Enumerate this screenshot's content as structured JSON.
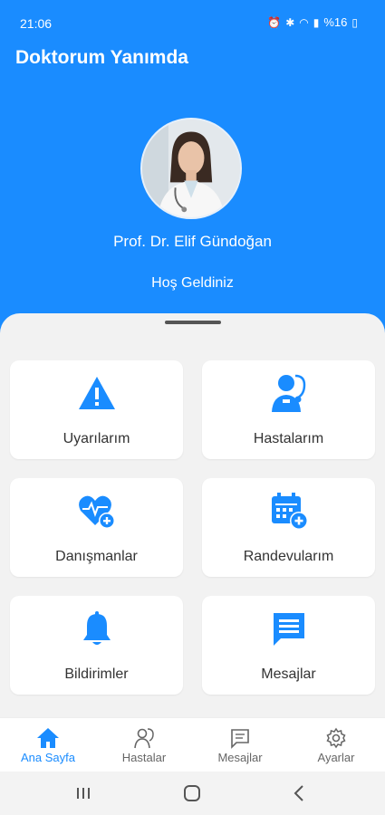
{
  "status": {
    "time": "21:06",
    "battery": "%16"
  },
  "app": {
    "title": "Doktorum Yanımda"
  },
  "profile": {
    "name": "Prof. Dr. Elif Gündoğan",
    "welcome": "Hoş Geldiniz"
  },
  "cards": [
    {
      "label": "Uyarılarım",
      "icon": "warning-icon"
    },
    {
      "label": "Hastalarım",
      "icon": "doctor-stethoscope-icon"
    },
    {
      "label": "Danışmanlar",
      "icon": "heart-plus-icon"
    },
    {
      "label": "Randevularım",
      "icon": "calendar-plus-icon"
    },
    {
      "label": "Bildirimler",
      "icon": "bell-icon"
    },
    {
      "label": "Mesajlar",
      "icon": "message-icon"
    }
  ],
  "nav": [
    {
      "label": "Ana Sayfa",
      "icon": "home-icon",
      "active": true
    },
    {
      "label": "Hastalar",
      "icon": "patients-icon",
      "active": false
    },
    {
      "label": "Mesajlar",
      "icon": "chat-icon",
      "active": false
    },
    {
      "label": "Ayarlar",
      "icon": "gear-icon",
      "active": false
    }
  ],
  "colors": {
    "primary": "#1a8cff",
    "sheet": "#f2f2f2",
    "card": "#ffffff",
    "text": "#333333"
  }
}
